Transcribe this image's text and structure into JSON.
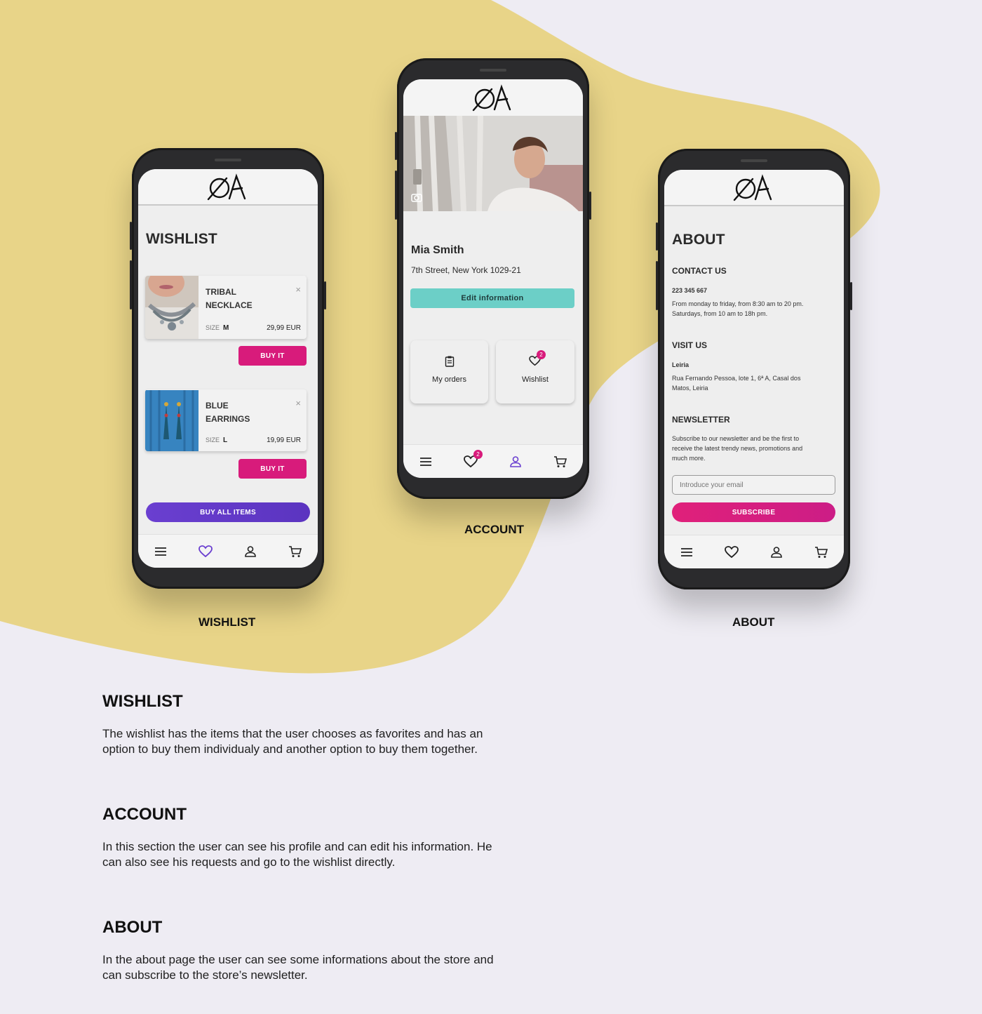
{
  "colors": {
    "blob": "#e8d488",
    "pink": "#d81b7b",
    "purple": "#5b34c0",
    "teal": "#6ccfc7",
    "nav_active": "#6a3fd0"
  },
  "brand": {
    "logo_icon": "oa-logo-icon"
  },
  "wishlist": {
    "title": "WISHLIST",
    "items": [
      {
        "name_line1": "TRIBAL",
        "name_line2": "NECKLACE",
        "size_label": "SIZE",
        "size": "M",
        "price": "29,99 EUR",
        "close": "×",
        "buy": "BUY IT"
      },
      {
        "name_line1": "BLUE",
        "name_line2": "EARRINGS",
        "size_label": "SIZE",
        "size": "L",
        "price": "19,99 EUR",
        "close": "×",
        "buy": "BUY IT"
      }
    ],
    "buy_all": "BUY ALL ITEMS",
    "caption": "WISHLIST"
  },
  "account": {
    "name": "Mia Smith",
    "address": "7th Street, New York 1029-21",
    "edit": "Edit information",
    "orders": "My orders",
    "wishlist": "Wishlist",
    "wishlist_badge": "2",
    "nav_badge": "2",
    "caption": "ACCOUNT"
  },
  "about": {
    "title": "ABOUT",
    "contact_title": "CONTACT US",
    "phone": "223 345 667",
    "hours1": "From monday to friday, from 8:30 am to 20 pm.",
    "hours2": "Saturdays, from 10 am to 18h pm.",
    "visit_title": "VISIT US",
    "city": "Leiria",
    "addr1": "Rua Fernando Pessoa, lote 1, 6ª A, Casal dos",
    "addr2": "Matos, Leiria",
    "news_title": "NEWSLETTER",
    "news1": "Subscribe to our newsletter and be the first to",
    "news2": "receive the latest trendy news, promotions and",
    "news3": "much more.",
    "email_placeholder": "Introduce your email",
    "subscribe": "SUBSCRIBE",
    "caption": "ABOUT"
  },
  "sections": [
    {
      "title": "WISHLIST",
      "text": "The wishlist has the items that the user chooses as favorites and has an option to buy them individualy and another option to buy them together."
    },
    {
      "title": "ACCOUNT",
      "text": "In this section the user can see his profile and can edit his information. He can also see his requests and go to the wishlist directly."
    },
    {
      "title": "ABOUT",
      "text": "In the about page the user can see some informations about the store and can subscribe to the store’s newsletter."
    }
  ]
}
